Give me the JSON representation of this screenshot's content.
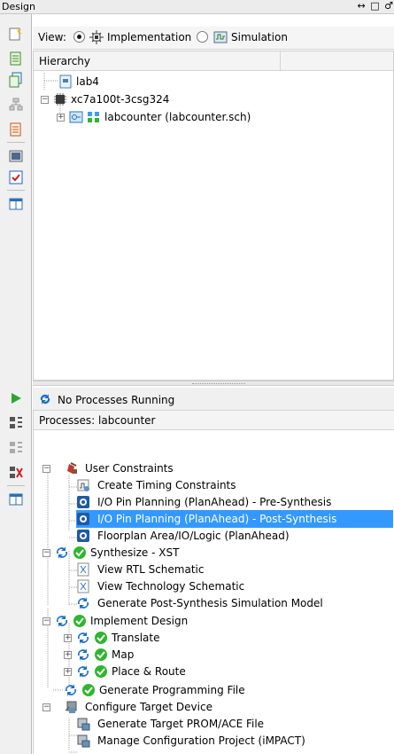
{
  "panel": {
    "title": "Design",
    "window_controls": "↔ □ ♂"
  },
  "view": {
    "label": "View:",
    "options": [
      "Implementation",
      "Simulation"
    ],
    "selected": "Implementation"
  },
  "hierarchy": {
    "header": "Hierarchy",
    "nodes": [
      {
        "label": "lab4",
        "icon": "project-file-icon"
      },
      {
        "label": "xc7a100t-3csg324",
        "icon": "chip-icon"
      },
      {
        "label": "labcounter (labcounter.sch)",
        "icon": "schematic-module-icon"
      }
    ]
  },
  "status": {
    "text": "No Processes Running"
  },
  "processes": {
    "header": "Processes: labcounter",
    "items": [
      {
        "label": "User Constraints",
        "icon": "constraints-icon"
      },
      {
        "label": "Create Timing Constraints",
        "icon": "timing-icon"
      },
      {
        "label": "I/O Pin Planning (PlanAhead) - Pre-Synthesis",
        "icon": "planahead-icon"
      },
      {
        "label": "I/O Pin Planning (PlanAhead) - Post-Synthesis",
        "icon": "planahead-icon",
        "selected": true
      },
      {
        "label": "Floorplan Area/IO/Logic (PlanAhead)",
        "icon": "planahead-icon"
      },
      {
        "label": "Synthesize - XST",
        "icon": "process-ok-icon"
      },
      {
        "label": "View RTL Schematic",
        "icon": "schematic-view-icon"
      },
      {
        "label": "View Technology Schematic",
        "icon": "schematic-view-icon"
      },
      {
        "label": "Generate Post-Synthesis Simulation Model",
        "icon": "run-icon"
      },
      {
        "label": "Implement Design",
        "icon": "process-ok-icon"
      },
      {
        "label": "Translate",
        "icon": "process-ok-icon"
      },
      {
        "label": "Map",
        "icon": "process-ok-icon"
      },
      {
        "label": "Place & Route",
        "icon": "process-ok-icon"
      },
      {
        "label": "Generate Programming File",
        "icon": "process-ok-icon"
      },
      {
        "label": "Configure Target Device",
        "icon": "device-icon"
      },
      {
        "label": "Generate Target PROM/ACE File",
        "icon": "device-file-icon"
      },
      {
        "label": "Manage Configuration Project (iMPACT)",
        "icon": "device-file-icon"
      }
    ]
  },
  "colors": {
    "selection": "#3399ff",
    "success_green": "#2fb52f",
    "run_blue": "#1a6fc9"
  }
}
